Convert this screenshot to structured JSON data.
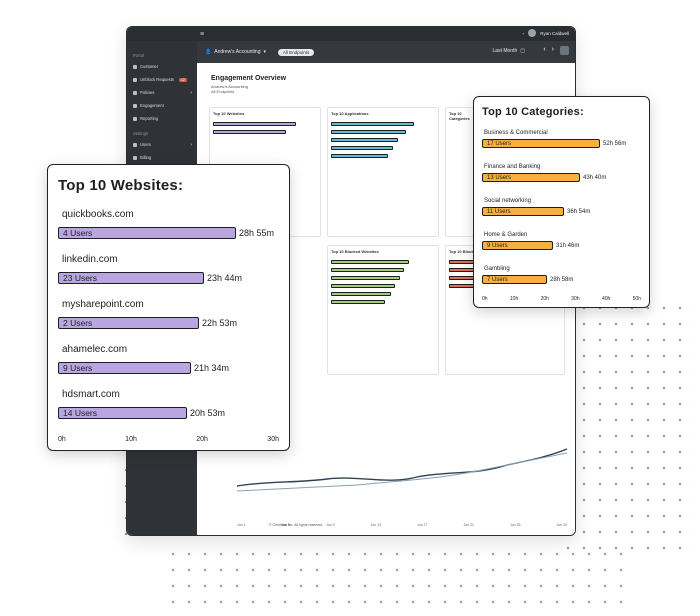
{
  "app": {
    "topbar": {
      "menu_icon": "menu-icon",
      "user_name": "Ryan Caldwell"
    },
    "subbar": {
      "account": "Andrew's Accounting",
      "endpoints": "All Endpoints",
      "period": "Last Month"
    },
    "sidebar": {
      "heading_portal": "Portal",
      "heading_settings": "Settings",
      "items": [
        {
          "label": "Customer"
        },
        {
          "label": "Unblock Requests",
          "badge": "12"
        },
        {
          "label": "Policies"
        },
        {
          "label": "Engagement"
        },
        {
          "label": "Reporting"
        },
        {
          "label": "Users"
        },
        {
          "label": "Billing"
        }
      ]
    },
    "report": {
      "title": "Engagement Overview",
      "meta_line1": "Andrew's Accounting",
      "meta_line2": "All Endpoints",
      "panels": [
        {
          "title": "Top 10 Websites",
          "color": "#b9a6e0"
        },
        {
          "title": "Top 10 Applications",
          "color": "#5bc0d8"
        },
        {
          "title": "Top 10 Categories",
          "color": "#f6b041"
        },
        {
          "title": "Top 10 Blocked Websites",
          "color": "#9fce7e"
        },
        {
          "title": "Top 10 Blocked Categories",
          "color": "#d9705a"
        }
      ],
      "footer": "© Cerulean Inc. All rights reserved."
    }
  },
  "websites_card": {
    "title": "Top 10 Websites:",
    "axis_ticks": [
      "0h",
      "10h",
      "20h",
      "30h"
    ],
    "rows": [
      {
        "site": "quickbooks.com",
        "users": "4 Users",
        "value": "28h 55m",
        "hours": 28.9
      },
      {
        "site": "linkedin.com",
        "users": "23 Users",
        "value": "23h 44m",
        "hours": 23.7
      },
      {
        "site": "mysharepoint.com",
        "users": "2 Users",
        "value": "22h 53m",
        "hours": 22.9
      },
      {
        "site": "ahamelec.com",
        "users": "9 Users",
        "value": "21h 34m",
        "hours": 21.6
      },
      {
        "site": "hdsmart.com",
        "users": "14 Users",
        "value": "20h 53m",
        "hours": 20.9
      }
    ]
  },
  "categories_card": {
    "title": "Top 10 Categories:",
    "axis_ticks": [
      "0h",
      "10h",
      "20h",
      "30h",
      "40h",
      "50h"
    ],
    "rows": [
      {
        "category": "Business & Commercial",
        "users": "17 Users",
        "value": "52h 56m",
        "hours": 52.9
      },
      {
        "category": "Finance and Banking",
        "users": "13 Users",
        "value": "43h 40m",
        "hours": 43.7
      },
      {
        "category": "Social networking",
        "users": "11 Users",
        "value": "36h 54m",
        "hours": 36.9
      },
      {
        "category": "Home & Garden",
        "users": "9 Users",
        "value": "31h 46m",
        "hours": 31.8
      },
      {
        "category": "Gambling",
        "users": "7 Users",
        "value": "28h 58m",
        "hours": 28.9
      }
    ]
  },
  "trend_axis": [
    "Jun 1",
    "Jun 5",
    "Jun 9",
    "Jun 13",
    "Jun 17",
    "Jun 21",
    "Jun 25",
    "Jun 29"
  ]
}
